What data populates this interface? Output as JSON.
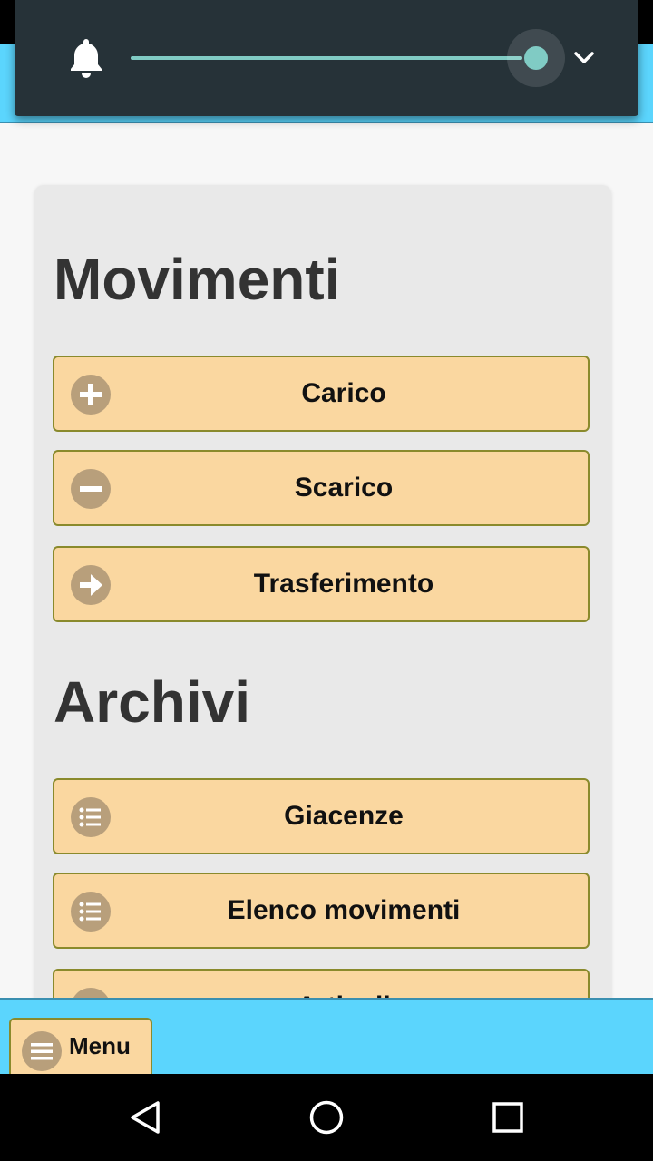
{
  "volume_panel": {
    "icon": "bell-icon",
    "level": 1.0,
    "accent_color": "#80cbc4",
    "expand_icon": "chevron-down-icon"
  },
  "sections": [
    {
      "title": "Movimenti",
      "buttons": [
        {
          "label": "Carico",
          "icon": "plus-circle-icon"
        },
        {
          "label": "Scarico",
          "icon": "minus-circle-icon"
        },
        {
          "label": "Trasferimento",
          "icon": "arrow-right-circle-icon"
        }
      ]
    },
    {
      "title": "Archivi",
      "buttons": [
        {
          "label": "Giacenze",
          "icon": "list-icon"
        },
        {
          "label": "Elenco movimenti",
          "icon": "list-icon"
        },
        {
          "label": "Articoli",
          "icon": "list-icon"
        }
      ]
    }
  ],
  "bottom_bar": {
    "menu_label": "Menu",
    "menu_icon": "hamburger-icon"
  },
  "navigation": {
    "back_icon": "back-triangle-icon",
    "home_icon": "home-circle-icon",
    "recents_icon": "recents-square-icon"
  },
  "colors": {
    "header_bg": "#5bd5fd",
    "button_bg": "#fad7a0",
    "button_border": "#8a8a2c",
    "icon_bg": "#b89f7b",
    "panel_bg": "#263238"
  }
}
